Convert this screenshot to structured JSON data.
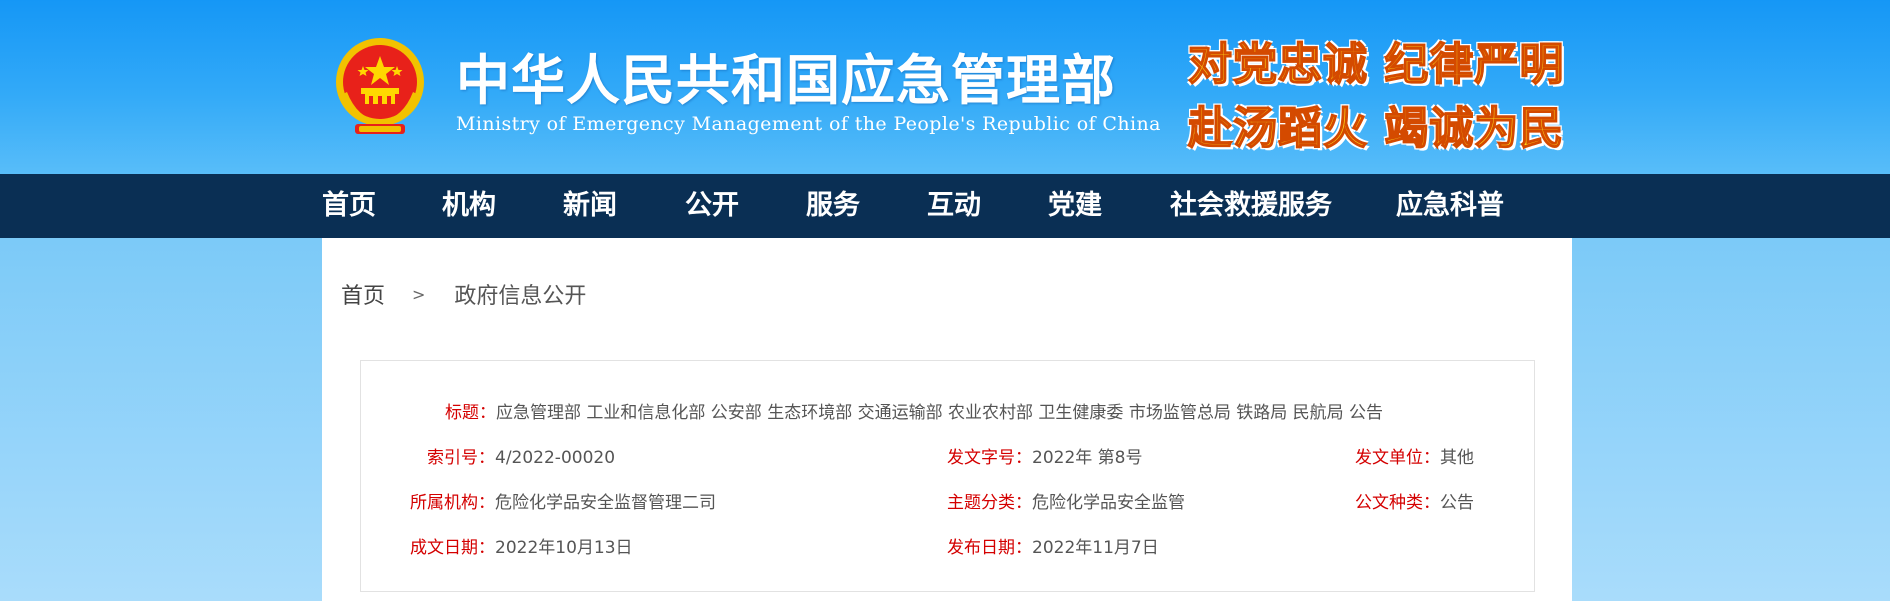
{
  "header": {
    "title_cn": "中华人民共和国应急管理部",
    "title_en": "Ministry of Emergency Management of the People's Republic of China",
    "slogan_line1": "对党忠诚 纪律严明",
    "slogan_line2": "赴汤蹈火 竭诚为民",
    "emblem_icon": "national-emblem-icon"
  },
  "nav": {
    "items": [
      {
        "label": "首页"
      },
      {
        "label": "机构"
      },
      {
        "label": "新闻"
      },
      {
        "label": "公开"
      },
      {
        "label": "服务"
      },
      {
        "label": "互动"
      },
      {
        "label": "党建"
      },
      {
        "label": "社会救援服务"
      },
      {
        "label": "应急科普"
      }
    ]
  },
  "breadcrumb": {
    "home": "首页",
    "separator": ">",
    "current": "政府信息公开"
  },
  "info": {
    "title_label": "标题：",
    "title_value": "应急管理部 工业和信息化部 公安部 生态环境部 交通运输部 农业农村部 卫生健康委 市场监管总局 铁路局 民航局 公告",
    "index_label": "索引号：",
    "index_value": "4/2022-00020",
    "doc_no_label": "发文字号：",
    "doc_no_value": "2022年 第8号",
    "issuer_label": "发文单位：",
    "issuer_value": "其他",
    "org_label": "所属机构：",
    "org_value": "危险化学品安全监督管理二司",
    "topic_label": "主题分类：",
    "topic_value": "危险化学品安全监管",
    "type_label": "公文种类：",
    "type_value": "公告",
    "written_label": "成文日期：",
    "written_value": "2022年10月13日",
    "published_label": "发布日期：",
    "published_value": "2022年11月7日"
  },
  "colors": {
    "nav_bg": "#0a2f54",
    "label_red": "#d40000",
    "value_gray": "#555555",
    "banner_blue": "#1597f6",
    "slogan_fill": "#ffdc1a"
  }
}
